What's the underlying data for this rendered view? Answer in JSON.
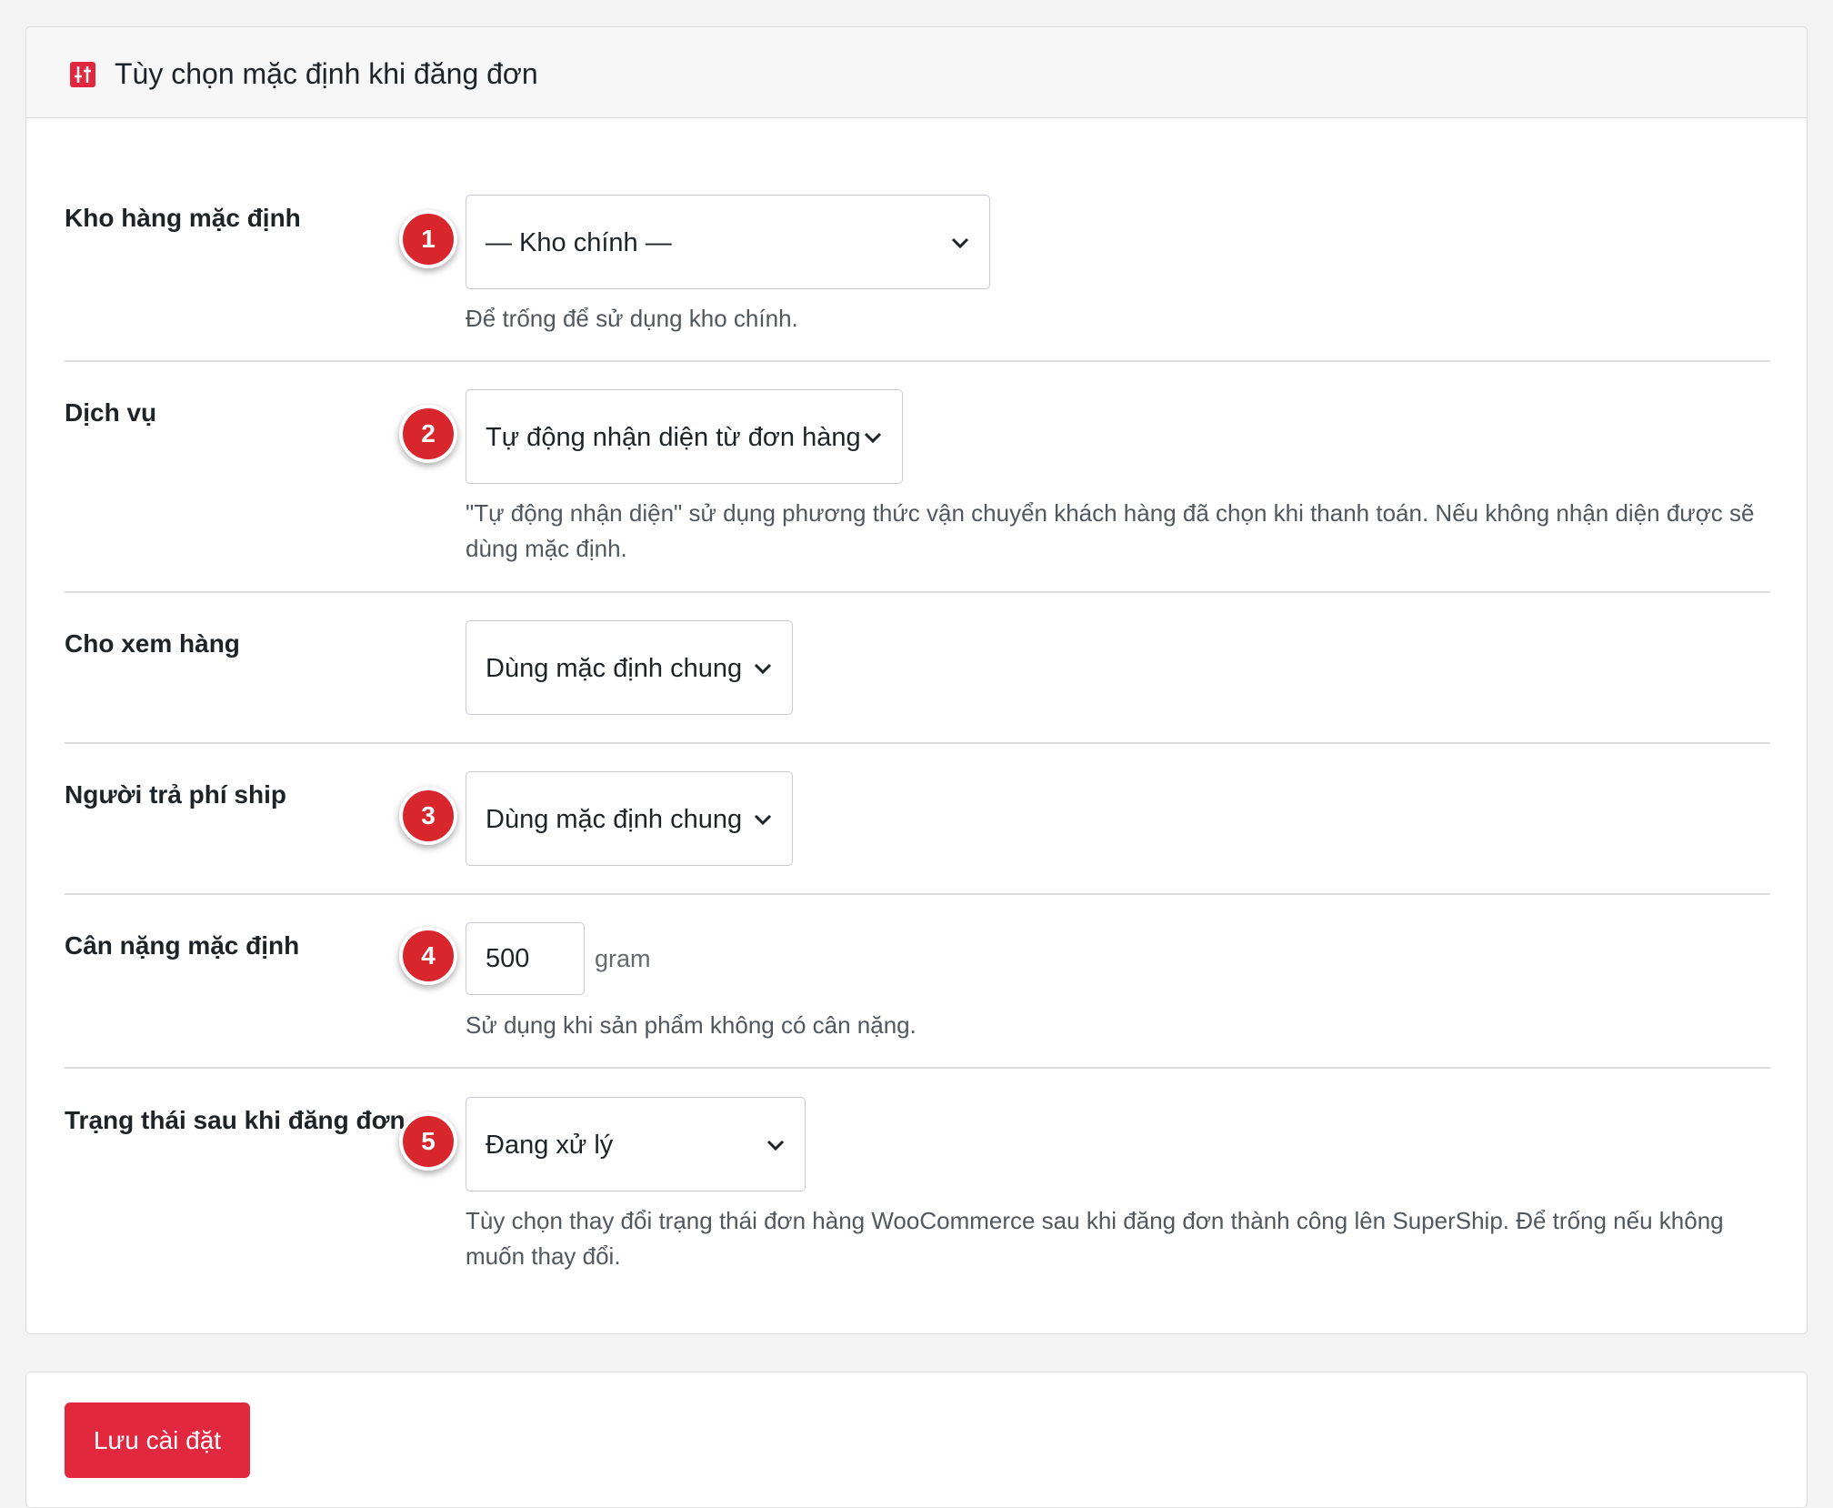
{
  "header": {
    "title": "Tùy chọn mặc định khi đăng đơn",
    "icon": "sliders-icon"
  },
  "fields": [
    {
      "label": "Kho hàng mặc định",
      "badge": "1",
      "selected": "— Kho chính —",
      "description": "Để trống để sử dụng kho chính."
    },
    {
      "label": "Dịch vụ",
      "badge": "2",
      "selected": "Tự động nhận diện từ đơn hàng",
      "description": "\"Tự động nhận diện\" sử dụng phương thức vận chuyển khách hàng đã chọn khi thanh toán. Nếu không nhận diện được sẽ dùng mặc định."
    },
    {
      "label": "Cho xem hàng",
      "selected": "Dùng mặc định chung"
    },
    {
      "label": "Người trả phí ship",
      "badge": "3",
      "selected": "Dùng mặc định chung"
    },
    {
      "label": "Cân nặng mặc định",
      "badge": "4",
      "value": "500",
      "unit": "gram",
      "description": "Sử dụng khi sản phẩm không có cân nặng."
    },
    {
      "label": "Trạng thái sau khi đăng đơn",
      "badge": "5",
      "selected": "Đang xử lý",
      "description": "Tùy chọn thay đổi trạng thái đơn hàng WooCommerce sau khi đăng đơn thành công lên SuperShip. Để trống nếu không muốn thay đổi."
    }
  ],
  "actions": {
    "save_label": "Lưu cài đặt"
  },
  "colors": {
    "accent": "#e2283f",
    "badge": "#d9262d"
  }
}
